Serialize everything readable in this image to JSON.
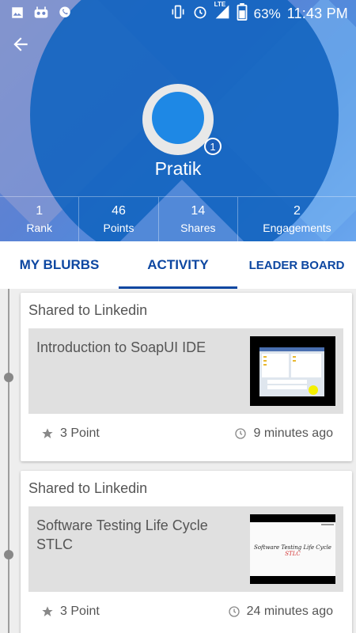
{
  "status_bar": {
    "battery": "63%",
    "time": "11:43 PM",
    "network": "LTE"
  },
  "profile": {
    "name": "Pratik",
    "badge": "1"
  },
  "stats": [
    {
      "value": "1",
      "label": "Rank"
    },
    {
      "value": "46",
      "label": "Points"
    },
    {
      "value": "14",
      "label": "Shares"
    },
    {
      "value": "2",
      "label": "Engagements"
    }
  ],
  "tabs": [
    {
      "label": "MY BLURBS",
      "active": false
    },
    {
      "label": "ACTIVITY",
      "active": true
    },
    {
      "label": "LEADER BOARD",
      "active": false
    }
  ],
  "feed": [
    {
      "shared_to": "Shared to Linkedin",
      "title": "Introduction to SoapUI IDE",
      "points": "3 Point",
      "time": "9 minutes ago"
    },
    {
      "shared_to": "Shared to Linkedin",
      "title": "Software Testing Life Cycle STLC",
      "points": "3 Point",
      "time": "24 minutes ago",
      "thumb_text": "Software Testing Life Cycle",
      "thumb_text_accent": "STLC"
    }
  ],
  "colors": {
    "accent": "#0d47a1",
    "header_circle": "#1565c0"
  }
}
